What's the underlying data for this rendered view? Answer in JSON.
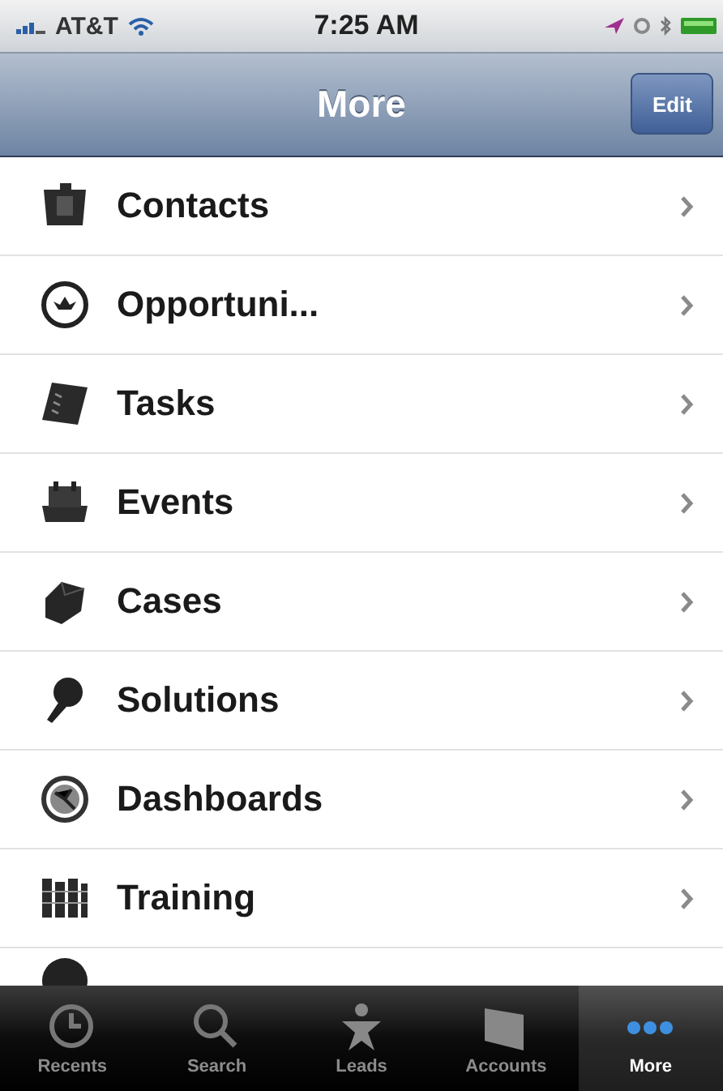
{
  "status_bar": {
    "carrier": "AT&T",
    "time": "7:25 AM"
  },
  "nav_bar": {
    "title": "More",
    "edit_button": "Edit"
  },
  "items": [
    {
      "label": "Contacts",
      "kind": "contacts"
    },
    {
      "label": "Opportuni...",
      "kind": "opportunities"
    },
    {
      "label": "Tasks",
      "kind": "tasks"
    },
    {
      "label": "Events",
      "kind": "events"
    },
    {
      "label": "Cases",
      "kind": "cases"
    },
    {
      "label": "Solutions",
      "kind": "solutions"
    },
    {
      "label": "Dashboards",
      "kind": "dashboards"
    },
    {
      "label": "Training",
      "kind": "training"
    }
  ],
  "tab_bar": [
    {
      "label": "Recents",
      "kind": "recents",
      "selected": false
    },
    {
      "label": "Search",
      "kind": "search",
      "selected": false
    },
    {
      "label": "Leads",
      "kind": "leads",
      "selected": false
    },
    {
      "label": "Accounts",
      "kind": "accounts",
      "selected": false
    },
    {
      "label": "More",
      "kind": "more",
      "selected": true
    }
  ]
}
